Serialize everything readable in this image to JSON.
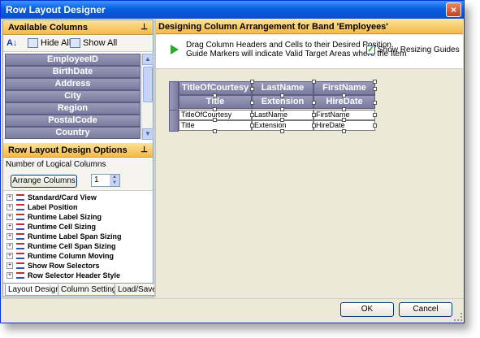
{
  "window": {
    "title": "Row Layout Designer"
  },
  "available_columns": {
    "header": "Available Columns",
    "toolbar": {
      "sort_icon": "sort-az-icon",
      "hide_all": "Hide All",
      "show_all": "Show All"
    },
    "items": [
      "EmployeeID",
      "BirthDate",
      "Address",
      "City",
      "Region",
      "PostalCode",
      "Country"
    ]
  },
  "options_panel": {
    "header": "Row Layout Design Options",
    "logical_columns_label": "Number of Logical Columns",
    "arrange_button": "Arrange Columns",
    "logical_columns_value": "1",
    "items": [
      "Standard/Card View",
      "Label Position",
      "Runtime Label Sizing",
      "Runtime Cell Sizing",
      "Runtime Label Span Sizing",
      "Runtime Cell Span Sizing",
      "Runtime Column Moving",
      "Show Row Selectors",
      "Row Selector Header Style"
    ],
    "tabs": [
      "Layout Design",
      "Column Settings",
      "Load/Save"
    ],
    "active_tab": "Layout Design"
  },
  "designer": {
    "header": "Designing Column Arrangement for Band 'Employees'",
    "info_line1": "Drag Column Headers and Cells to their Desired Position.",
    "info_line2": "Guide Markers will indicate Valid Target Areas where the Item",
    "show_resizing_guides": "Show Resizing Guides",
    "show_resizing_guides_checked": true,
    "header_row1": [
      "TitleOfCourtesy",
      "LastName",
      "FirstName"
    ],
    "header_row2": [
      "Title",
      "Extension",
      "HireDate"
    ],
    "cell_row1": [
      "TitleOfCourtesy",
      "LastName",
      "FirstName"
    ],
    "cell_row2": [
      "Title",
      "Extension",
      "HireDate"
    ]
  },
  "footer": {
    "ok": "OK",
    "cancel": "Cancel"
  }
}
